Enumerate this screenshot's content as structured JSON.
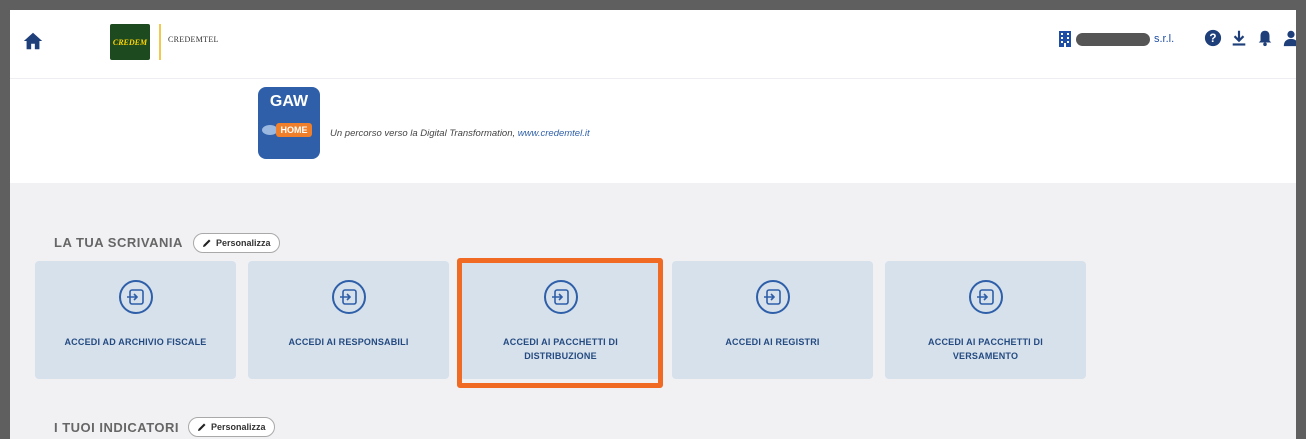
{
  "topbar": {
    "credem_logo_text": "CREDEM",
    "brand_name": "CREDEMTEL",
    "company_name_suffix": "s.r.l.",
    "icons": [
      "home-icon",
      "building-icon",
      "help-icon",
      "download-icon",
      "bell-icon",
      "user-icon"
    ]
  },
  "banner": {
    "gaw_title": "GAW",
    "gaw_home": "HOME",
    "tagline_text": "Un percorso verso la Digital Transformation, ",
    "tagline_link": "www.credemtel.it"
  },
  "desk": {
    "title": "LA TUA SCRIVANIA",
    "customize_label": "Personalizza",
    "cards": [
      {
        "label": "ACCEDI AD ARCHIVIO FISCALE"
      },
      {
        "label": "ACCEDI AI RESPONSABILI"
      },
      {
        "label": "ACCEDI AI PACCHETTI DI DISTRIBUZIONE"
      },
      {
        "label": "ACCEDI AI REGISTRI"
      },
      {
        "label": "ACCEDI AI PACCHETTI DI VERSAMENTO"
      }
    ]
  },
  "indicators": {
    "title": "I TUOI INDICATORI",
    "customize_label": "Personalizza"
  },
  "colors": {
    "accent": "#1f4fa5",
    "card_bg": "#d6e1ec",
    "highlight": "#f06a24",
    "page_bg": "#f1f1f4"
  }
}
